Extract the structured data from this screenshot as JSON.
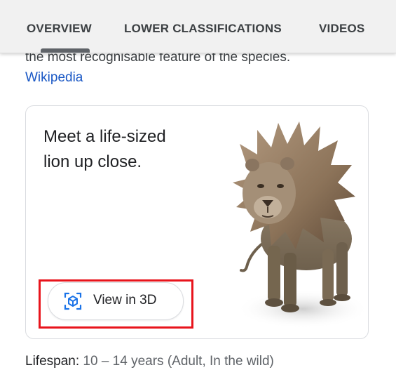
{
  "tabs": [
    {
      "label": "OVERVIEW",
      "active": true
    },
    {
      "label": "LOWER CLASSIFICATIONS",
      "active": false
    },
    {
      "label": "VIDEOS",
      "active": false
    }
  ],
  "description": {
    "text": "the most recognisable feature of the species.",
    "source_link": "Wikipedia"
  },
  "ar_card": {
    "headline": "Meet a life-sized lion up close.",
    "button_label": "View in 3D",
    "button_icon": "3d-cube-scan-icon",
    "image": "lion-3d-model"
  },
  "facts": {
    "lifespan_label": "Lifespan:",
    "lifespan_value": "10 – 14 years (Adult, In the wild)"
  },
  "colors": {
    "link": "#1a58c5",
    "accent_blue": "#1a73e8",
    "highlight": "#e8141c",
    "tab_bg": "#f1f1f1"
  }
}
